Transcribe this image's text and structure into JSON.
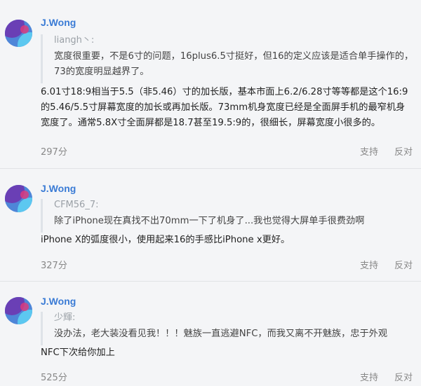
{
  "comments": [
    {
      "username": "J.Wong",
      "quote_author": "liangh丶:",
      "quote_text": "宽度很重要，不是6寸的问题，16plus6.5寸挺好，但16的定义应该是适合单手操作的，73的宽度明显越界了。",
      "body": "6.01寸18:9相当于5.5（非5.46）寸的加长版，基本市面上6.2/6.28寸等等都是这个16:9的5.46/5.5寸屏幕宽度的加长或再加长版。73mm机身宽度已经是全面屏手机的最窄机身宽度了。通常5.8X寸全面屏都是18.7甚至19.5:9的，很细长，屏幕宽度小很多的。",
      "score": "297分",
      "support": "支持",
      "oppose": "反对"
    },
    {
      "username": "J.Wong",
      "quote_author": "CFM56_7:",
      "quote_text": "除了iPhone现在真找不出70mm一下了机身了...我也觉得大屏单手很费劲啊",
      "body": "iPhone X的弧度很小，使用起来16的手感比iPhone x更好。",
      "score": "327分",
      "support": "支持",
      "oppose": "反对"
    },
    {
      "username": "J.Wong",
      "quote_author": "少輝:",
      "quote_text": "没办法，老大装没看见我！！！魅族一直逃避NFC，而我又离不开魅族，忠于外观",
      "body": "NFC下次给你加上",
      "score": "525分",
      "support": "支持",
      "oppose": "反对"
    }
  ],
  "colors": {
    "username": "#3a7bd5",
    "background": "#f4f5f7",
    "avatar_blue": "#4e86d8",
    "avatar_purple": "#6a3fb5",
    "avatar_cyan": "#5cc8f0"
  }
}
